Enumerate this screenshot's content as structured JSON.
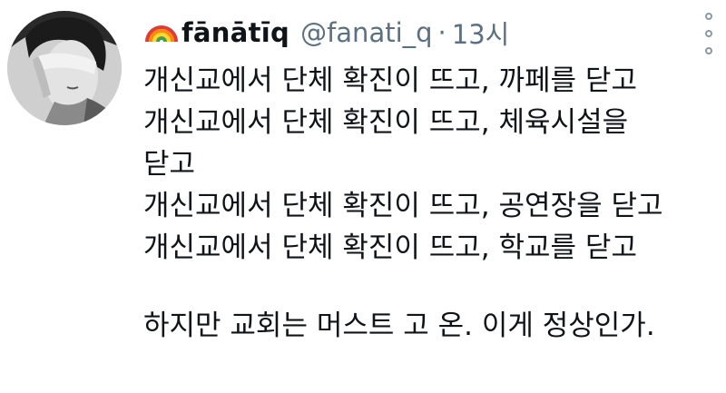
{
  "tweet": {
    "author": {
      "display_name": "fānātīq",
      "handle": "@fanati_q",
      "avatar_icon": "profile-photo"
    },
    "separator": "·",
    "timestamp": "13시",
    "emoji_icon": "rainbow-icon",
    "menu_icon": "more-options-icon",
    "text_lines": [
      "개신교에서 단체 확진이 뜨고, 까페를 닫고",
      "개신교에서 단체 확진이 뜨고, 체육시설을",
      "닫고",
      "개신교에서 단체 확진이 뜨고, 공연장을 닫고",
      "개신교에서 단체 확진이 뜨고, 학교를 닫고",
      "하지만 교회는 머스트 고 온. 이게 정상인가."
    ]
  },
  "colors": {
    "text_primary": "#0f1419",
    "text_secondary": "#5b7083",
    "background": "#ffffff"
  }
}
